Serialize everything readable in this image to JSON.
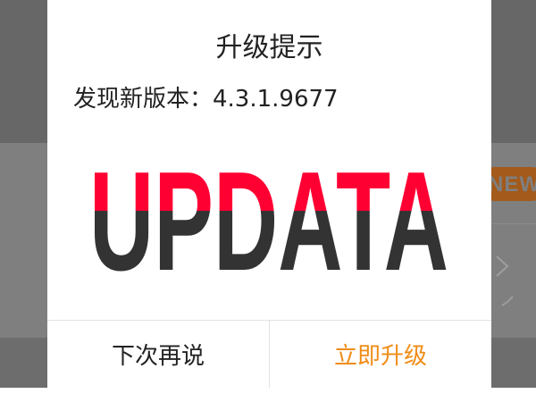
{
  "background": {
    "badge_label": "NEW",
    "icons": {
      "chevron": "chevron-right-icon",
      "tick": "check-icon"
    }
  },
  "dialog": {
    "title": "升级提示",
    "message": "发现新版本：4.3.1.9677",
    "banner_text": "UPDATA",
    "buttons": {
      "later": "下次再说",
      "upgrade": "立即升级"
    }
  },
  "colors": {
    "banner_top": "#ff0033",
    "banner_bottom": "#333333",
    "upgrade_accent": "#f08c16",
    "overlay_dark": "#676767",
    "overlay_mid": "#7f7f7f",
    "badge": "#a35a1a"
  }
}
